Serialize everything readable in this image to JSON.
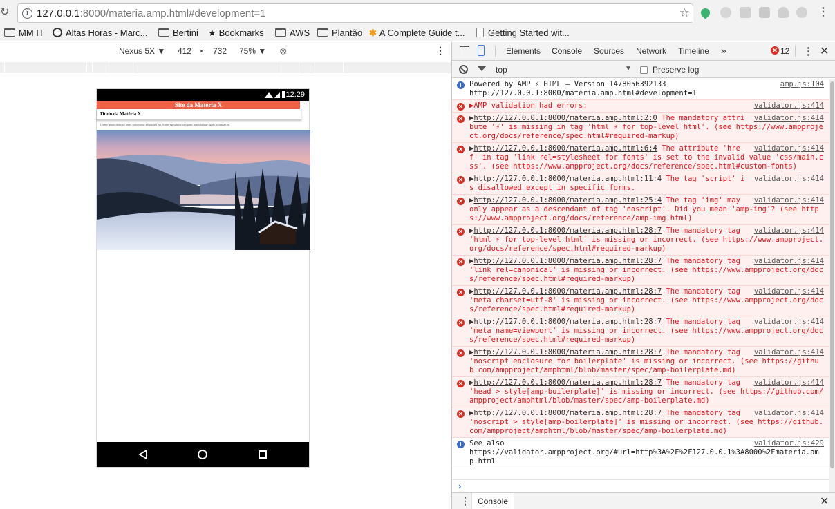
{
  "browser": {
    "url_host": "127.0.0.1",
    "url_rest": ":8000/materia.amp.html#development=1",
    "bookmarks": [
      {
        "label": "MM IT",
        "icon": "folder-icon"
      },
      {
        "label": "Altas Horas - Marc...",
        "icon": "globe-icon"
      },
      {
        "label": "Bertini",
        "icon": "folder-icon"
      },
      {
        "label": "Bookmarks",
        "icon": "star-icon"
      },
      {
        "label": "AWS",
        "icon": "folder-icon"
      },
      {
        "label": "Plantão",
        "icon": "folder-icon"
      },
      {
        "label": "A Complete Guide t...",
        "icon": "asterisk-icon"
      },
      {
        "label": "Getting Started wit...",
        "icon": "page-icon"
      }
    ]
  },
  "device_toolbar": {
    "device": "Nexus 5X",
    "width": "412",
    "times": "×",
    "height": "732",
    "zoom": "75%"
  },
  "phone": {
    "time": "12:29",
    "site_title": "Site da Matéria X",
    "article_title": "Titulo da Matéria X",
    "article_text": "Lorem ipsum dolor sit amet, consectetur adipiscing elit. Etiam egestas tortor sapien, non tristique ligula accumsan eu."
  },
  "devtools": {
    "tabs": [
      "Elements",
      "Console",
      "Sources",
      "Network",
      "Timeline"
    ],
    "more": "»",
    "active_tab": "Console",
    "error_count": "12",
    "context": "top",
    "preserve_log": "Preserve log",
    "drawer_tab": "Console",
    "colors": {
      "error": "#e0171b",
      "accent": "#3879d9"
    }
  },
  "console": {
    "messages": [
      {
        "level": "info",
        "source": "amp.js:104",
        "text": "Powered by AMP ⚡ HTML – Version 1478056392133\nhttp://127.0.0.1:8000/materia.amp.html#development=1"
      },
      {
        "level": "error",
        "source": "validator.js:414",
        "text": "▶AMP validation had errors:"
      },
      {
        "level": "error",
        "source": "validator.js:414",
        "link": "http://127.0.0.1:8000/materia.amp.html:2:0",
        "text": " The mandatory attribute '⚡' is missing in tag 'html ⚡ for top-level html'. (see https://www.ampproject.org/docs/reference/spec.html#required-markup)"
      },
      {
        "level": "error",
        "source": "validator.js:414",
        "link": "http://127.0.0.1:8000/materia.amp.html:6:4",
        "text": " The attribute 'href' in tag 'link rel=stylesheet for fonts' is set to the invalid value 'css/main.css'. (see https://www.ampproject.org/docs/reference/spec.html#custom-fonts)"
      },
      {
        "level": "error",
        "source": "validator.js:414",
        "link": "http://127.0.0.1:8000/materia.amp.html:11:4",
        "text": " The tag 'script' is disallowed except in specific forms."
      },
      {
        "level": "error",
        "source": "validator.js:414",
        "link": "http://127.0.0.1:8000/materia.amp.html:25:4",
        "text": " The tag 'img' may only appear as a descendant of tag 'noscript'. Did you mean 'amp-img'? (see https://www.ampproject.org/docs/reference/amp-img.html)"
      },
      {
        "level": "error",
        "source": "validator.js:414",
        "link": "http://127.0.0.1:8000/materia.amp.html:28:7",
        "text": " The mandatory tag 'html ⚡ for top-level html' is missing or incorrect. (see https://www.ampproject.org/docs/reference/spec.html#required-markup)"
      },
      {
        "level": "error",
        "source": "validator.js:414",
        "link": "http://127.0.0.1:8000/materia.amp.html:28:7",
        "text": " The mandatory tag 'link rel=canonical' is missing or incorrect. (see https://www.ampproject.org/docs/reference/spec.html#required-markup)"
      },
      {
        "level": "error",
        "source": "validator.js:414",
        "link": "http://127.0.0.1:8000/materia.amp.html:28:7",
        "text": " The mandatory tag 'meta charset=utf-8' is missing or incorrect. (see https://www.ampproject.org/docs/reference/spec.html#required-markup)"
      },
      {
        "level": "error",
        "source": "validator.js:414",
        "link": "http://127.0.0.1:8000/materia.amp.html:28:7",
        "text": " The mandatory tag 'meta name=viewport' is missing or incorrect. (see https://www.ampproject.org/docs/reference/spec.html#required-markup)"
      },
      {
        "level": "error",
        "source": "validator.js:414",
        "link": "http://127.0.0.1:8000/materia.amp.html:28:7",
        "text": " The mandatory tag 'noscript enclosure for boilerplate' is missing or incorrect. (see https://github.com/ampproject/amphtml/blob/master/spec/amp-boilerplate.md)"
      },
      {
        "level": "error",
        "source": "validator.js:414",
        "link": "http://127.0.0.1:8000/materia.amp.html:28:7",
        "text": " The mandatory tag 'head > style[amp-boilerplate]' is missing or incorrect. (see https://github.com/ampproject/amphtml/blob/master/spec/amp-boilerplate.md)"
      },
      {
        "level": "error",
        "source": "validator.js:414",
        "link": "http://127.0.0.1:8000/materia.amp.html:28:7",
        "text": " The mandatory tag 'noscript > style[amp-boilerplate]' is missing or incorrect. (see https://github.com/ampproject/amphtml/blob/master/spec/amp-boilerplate.md)"
      },
      {
        "level": "info",
        "source": "validator.js:429",
        "text": "See also\nhttps://validator.ampproject.org/#url=http%3A%2F%2F127.0.0.1%3A8000%2Fmateria.amp.html"
      }
    ]
  }
}
